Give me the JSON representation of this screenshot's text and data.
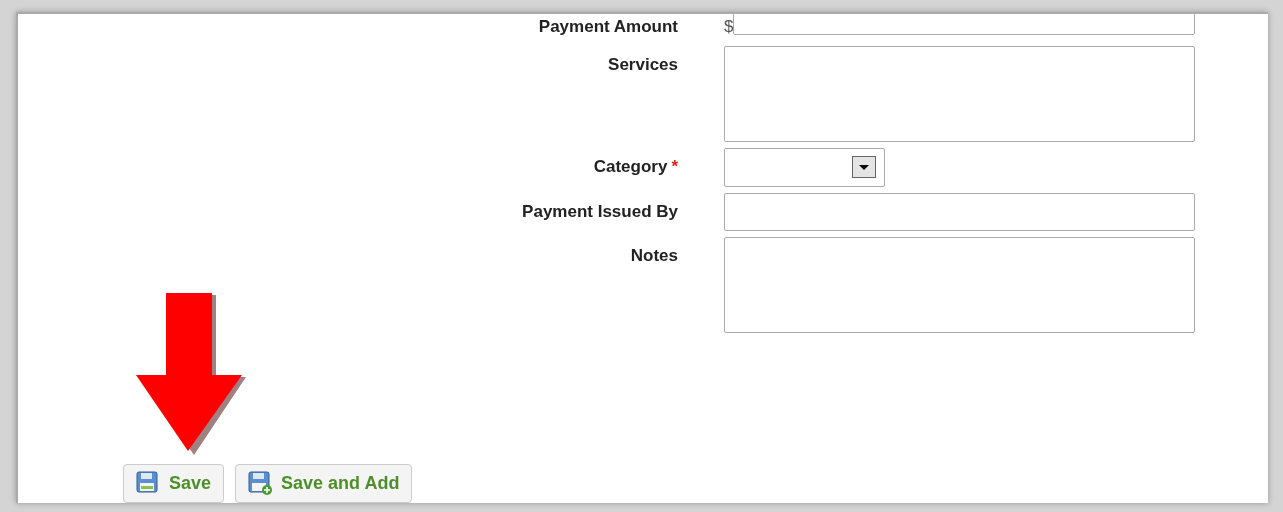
{
  "fields": [
    {
      "label": "Payment Amount",
      "kind": "currency",
      "prefix": "$",
      "required": false
    },
    {
      "label": "Services",
      "kind": "textarea",
      "required": false
    },
    {
      "label": "Category",
      "kind": "select",
      "required": true
    },
    {
      "label": "Payment Issued By",
      "kind": "text",
      "required": false
    },
    {
      "label": "Notes",
      "kind": "textarea",
      "required": false
    }
  ],
  "required_mark": "*",
  "buttons": [
    {
      "label": "Save",
      "kind": "save"
    },
    {
      "label": "Save and Add",
      "kind": "save_add"
    }
  ]
}
